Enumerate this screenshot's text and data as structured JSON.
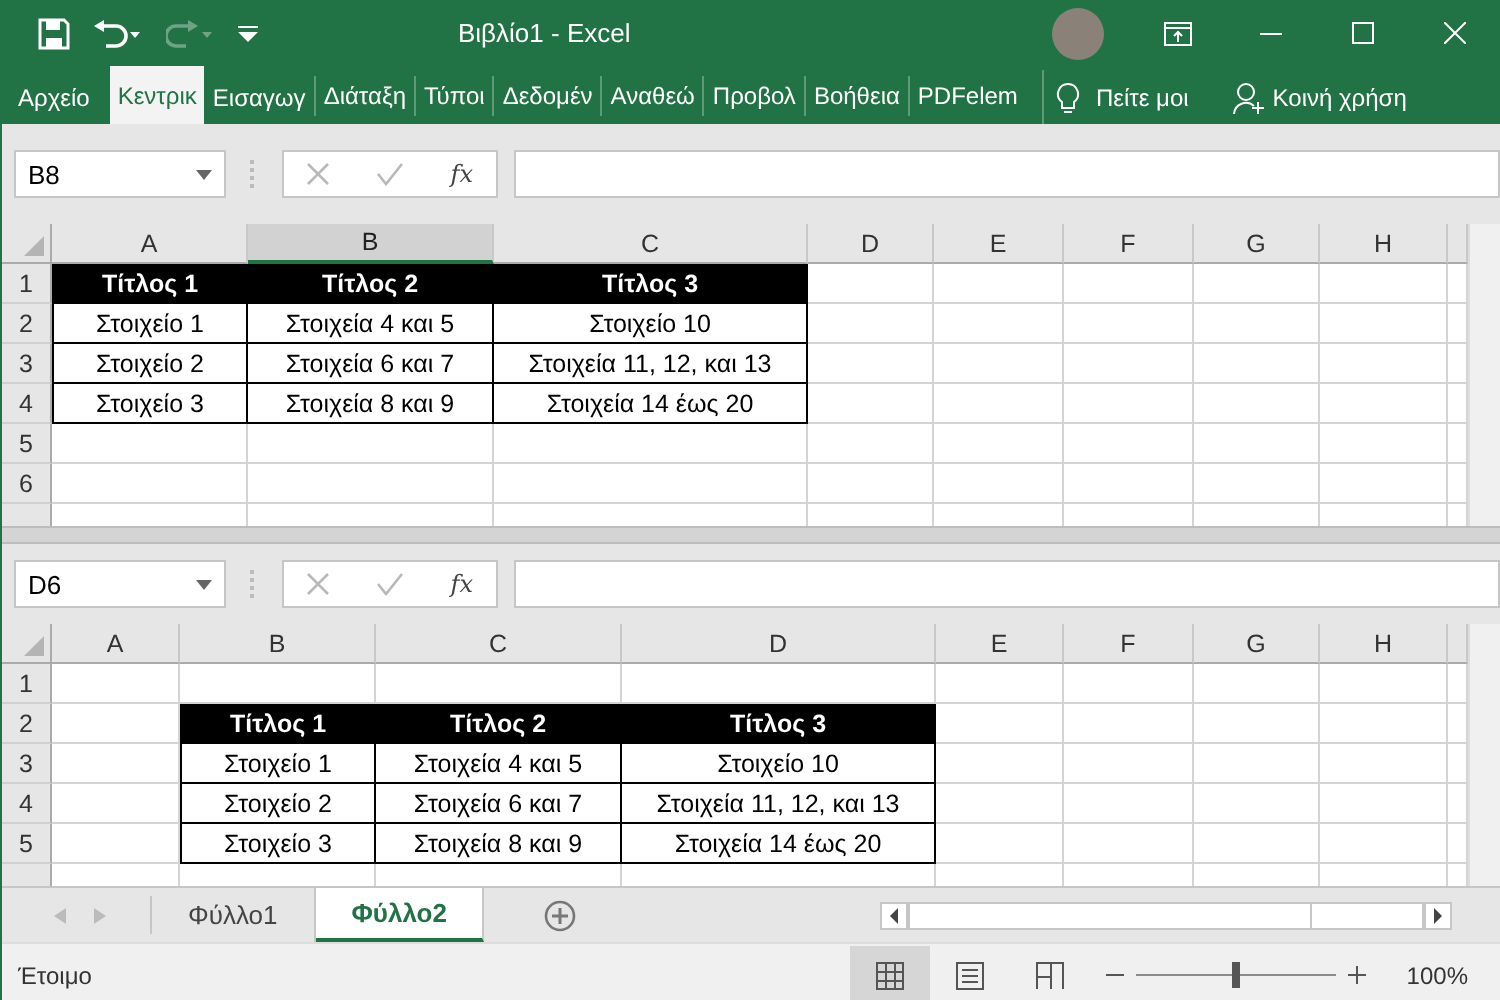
{
  "window": {
    "title": "Βιβλίο1  -  Excel"
  },
  "ribbon_tabs": [
    {
      "label": "Αρχείο",
      "selected": false
    },
    {
      "label": "Κεντρικ",
      "selected": true
    },
    {
      "label": "Εισαγωγ",
      "selected": false
    },
    {
      "label": "Διάταξη",
      "selected": false
    },
    {
      "label": "Τύποι",
      "selected": false
    },
    {
      "label": "Δεδομέν",
      "selected": false
    },
    {
      "label": "Αναθεώ",
      "selected": false
    },
    {
      "label": "Προβολ",
      "selected": false
    },
    {
      "label": "Βοήθεια",
      "selected": false
    },
    {
      "label": "PDFelem",
      "selected": false
    }
  ],
  "tell_me": "Πείτε μοι",
  "share": "Κοινή χρήση",
  "panes": [
    {
      "name_box": "B8",
      "fx_label": "fx",
      "columns": [
        {
          "label": "A",
          "selected": false
        },
        {
          "label": "B",
          "selected": true
        },
        {
          "label": "C",
          "selected": false
        },
        {
          "label": "D",
          "selected": false
        },
        {
          "label": "E",
          "selected": false
        },
        {
          "label": "F",
          "selected": false
        },
        {
          "label": "G",
          "selected": false
        },
        {
          "label": "H",
          "selected": false
        }
      ],
      "rows": [
        {
          "number": "1",
          "cells": [
            {
              "kind": "header",
              "text": "Τίτλος 1"
            },
            {
              "kind": "header",
              "text": "Τίτλος 2"
            },
            {
              "kind": "header",
              "text": "Τίτλος 3"
            }
          ]
        },
        {
          "number": "2",
          "cells": [
            {
              "kind": "data",
              "text": "Στοιχείο 1"
            },
            {
              "kind": "data",
              "text": "Στοιχεία 4 και 5"
            },
            {
              "kind": "data",
              "text": "Στοιχείο 10"
            }
          ]
        },
        {
          "number": "3",
          "cells": [
            {
              "kind": "data",
              "text": "Στοιχείο 2"
            },
            {
              "kind": "data",
              "text": "Στοιχεία 6 και 7"
            },
            {
              "kind": "data",
              "text": "Στοιχεία 11, 12, και 13"
            }
          ]
        },
        {
          "number": "4",
          "cells": [
            {
              "kind": "data",
              "text": "Στοιχείο 3"
            },
            {
              "kind": "data",
              "text": "Στοιχεία 8 και 9"
            },
            {
              "kind": "data",
              "text": "Στοιχεία 14 έως 20"
            }
          ]
        },
        {
          "number": "5",
          "cells": []
        },
        {
          "number": "6",
          "cells": []
        }
      ]
    },
    {
      "name_box": "D6",
      "fx_label": "fx",
      "columns": [
        {
          "label": "A",
          "selected": false
        },
        {
          "label": "B",
          "selected": false
        },
        {
          "label": "C",
          "selected": false
        },
        {
          "label": "D",
          "selected": false
        },
        {
          "label": "E",
          "selected": false
        },
        {
          "label": "F",
          "selected": false
        },
        {
          "label": "G",
          "selected": false
        },
        {
          "label": "H",
          "selected": false
        }
      ],
      "rows": [
        {
          "number": "1",
          "cells": []
        },
        {
          "number": "2",
          "cells": [
            {
              "kind": "blank"
            },
            {
              "kind": "header",
              "text": "Τίτλος 1"
            },
            {
              "kind": "header",
              "text": "Τίτλος 2"
            },
            {
              "kind": "header",
              "text": "Τίτλος 3"
            }
          ]
        },
        {
          "number": "3",
          "cells": [
            {
              "kind": "blank"
            },
            {
              "kind": "data",
              "text": "Στοιχείο 1"
            },
            {
              "kind": "data",
              "text": "Στοιχεία 4 και 5"
            },
            {
              "kind": "data",
              "text": "Στοιχείο 10"
            }
          ]
        },
        {
          "number": "4",
          "cells": [
            {
              "kind": "blank"
            },
            {
              "kind": "data",
              "text": "Στοιχείο 2"
            },
            {
              "kind": "data",
              "text": "Στοιχεία 6 και 7"
            },
            {
              "kind": "data",
              "text": "Στοιχεία 11, 12, και 13"
            }
          ]
        },
        {
          "number": "5",
          "cells": [
            {
              "kind": "blank"
            },
            {
              "kind": "data",
              "text": "Στοιχείο 3"
            },
            {
              "kind": "data",
              "text": "Στοιχεία 8 και 9"
            },
            {
              "kind": "data",
              "text": "Στοιχεία 14 έως 20"
            }
          ]
        }
      ]
    }
  ],
  "sheet_tabs": [
    {
      "label": "Φύλλο1",
      "selected": false
    },
    {
      "label": "Φύλλο2",
      "selected": true
    }
  ],
  "status_bar": {
    "text": "Έτοιμο",
    "view_modes": [
      {
        "kind": "normal",
        "selected": true
      },
      {
        "kind": "page-layout",
        "selected": false
      },
      {
        "kind": "page-break",
        "selected": false
      }
    ],
    "zoom": {
      "level": 0.5,
      "reading": "100%"
    }
  }
}
